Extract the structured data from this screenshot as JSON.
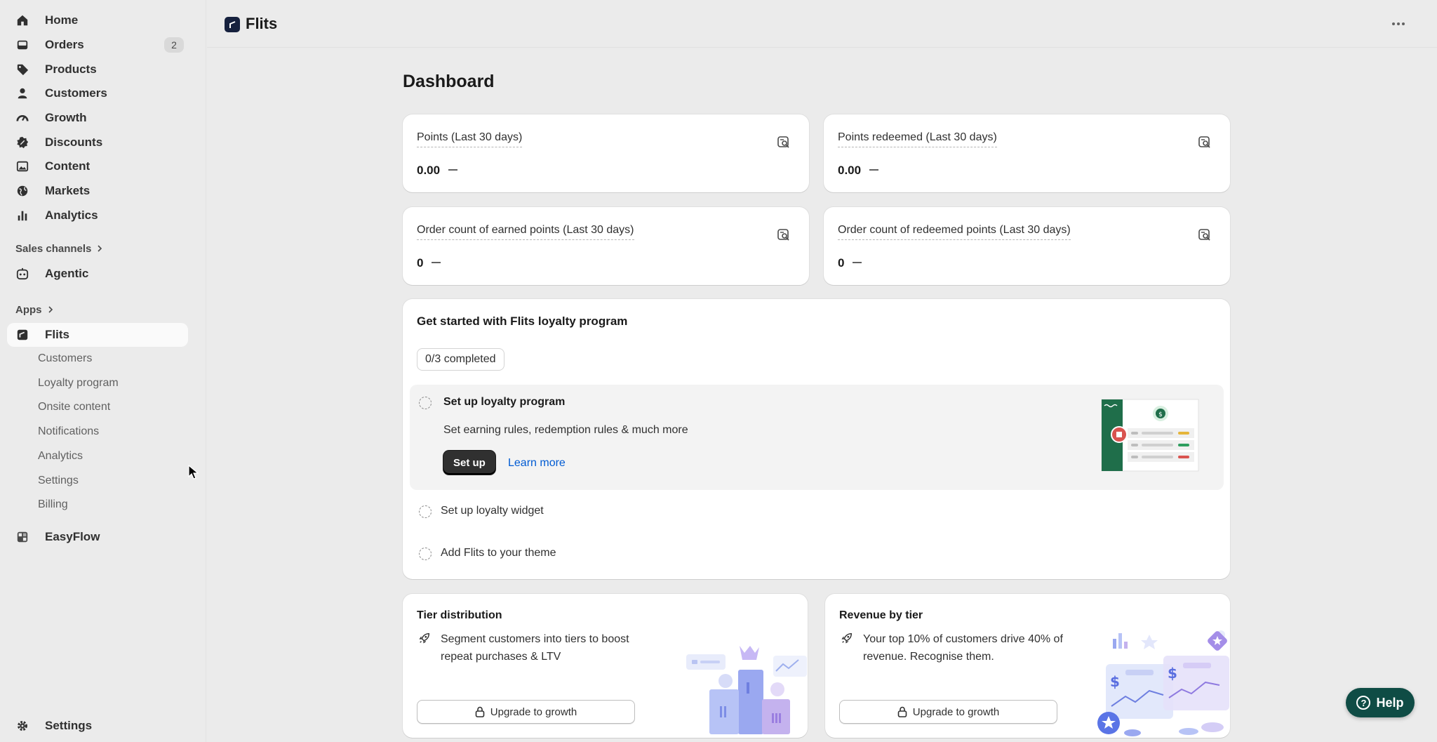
{
  "sidebar": {
    "items": [
      {
        "label": "Home",
        "icon": "home-icon"
      },
      {
        "label": "Orders",
        "icon": "inbox-icon",
        "badge": "2"
      },
      {
        "label": "Products",
        "icon": "tag-icon"
      },
      {
        "label": "Customers",
        "icon": "person-icon"
      },
      {
        "label": "Growth",
        "icon": "gauge-icon"
      },
      {
        "label": "Discounts",
        "icon": "discount-icon"
      },
      {
        "label": "Content",
        "icon": "image-icon"
      },
      {
        "label": "Markets",
        "icon": "globe-icon"
      },
      {
        "label": "Analytics",
        "icon": "bar-chart-icon"
      }
    ],
    "sales_channels_label": "Sales channels",
    "agentic_label": "Agentic",
    "apps_label": "Apps",
    "flits_label": "Flits",
    "flits_sub_items": [
      "Customers",
      "Loyalty program",
      "Onsite content",
      "Notifications",
      "Analytics",
      "Settings",
      "Billing"
    ],
    "easyflow_label": "EasyFlow",
    "settings_label": "Settings"
  },
  "topbar": {
    "app_title": "Flits"
  },
  "main": {
    "page_title": "Dashboard",
    "metrics": [
      {
        "label": "Points (Last 30 days)",
        "value": "0.00"
      },
      {
        "label": "Points redeemed (Last 30 days)",
        "value": "0.00"
      },
      {
        "label": "Order count of earned points (Last 30 days)",
        "value": "0"
      },
      {
        "label": "Order count of redeemed points (Last 30 days)",
        "value": "0"
      }
    ],
    "getting_started": {
      "title": "Get started with Flits loyalty program",
      "progress": "0/3 completed",
      "tasks": [
        {
          "title": "Set up loyalty program",
          "description": "Set earning rules, redemption rules & much more",
          "primary_action": "Set up",
          "secondary_action": "Learn more"
        },
        {
          "title": "Set up loyalty widget"
        },
        {
          "title": "Add Flits to your theme"
        }
      ]
    },
    "promos": [
      {
        "title": "Tier distribution",
        "text": "Segment customers into tiers to boost repeat purchases & LTV",
        "button": "Upgrade to growth"
      },
      {
        "title": "Revenue by tier",
        "text": "Your top 10% of customers drive 40% of revenue. Recognise them.",
        "button": "Upgrade to growth"
      }
    ]
  },
  "help_label": "Help",
  "colors": {
    "help_bg": "#0f4c45",
    "link": "#005bd3",
    "primary_button": "#303030"
  }
}
